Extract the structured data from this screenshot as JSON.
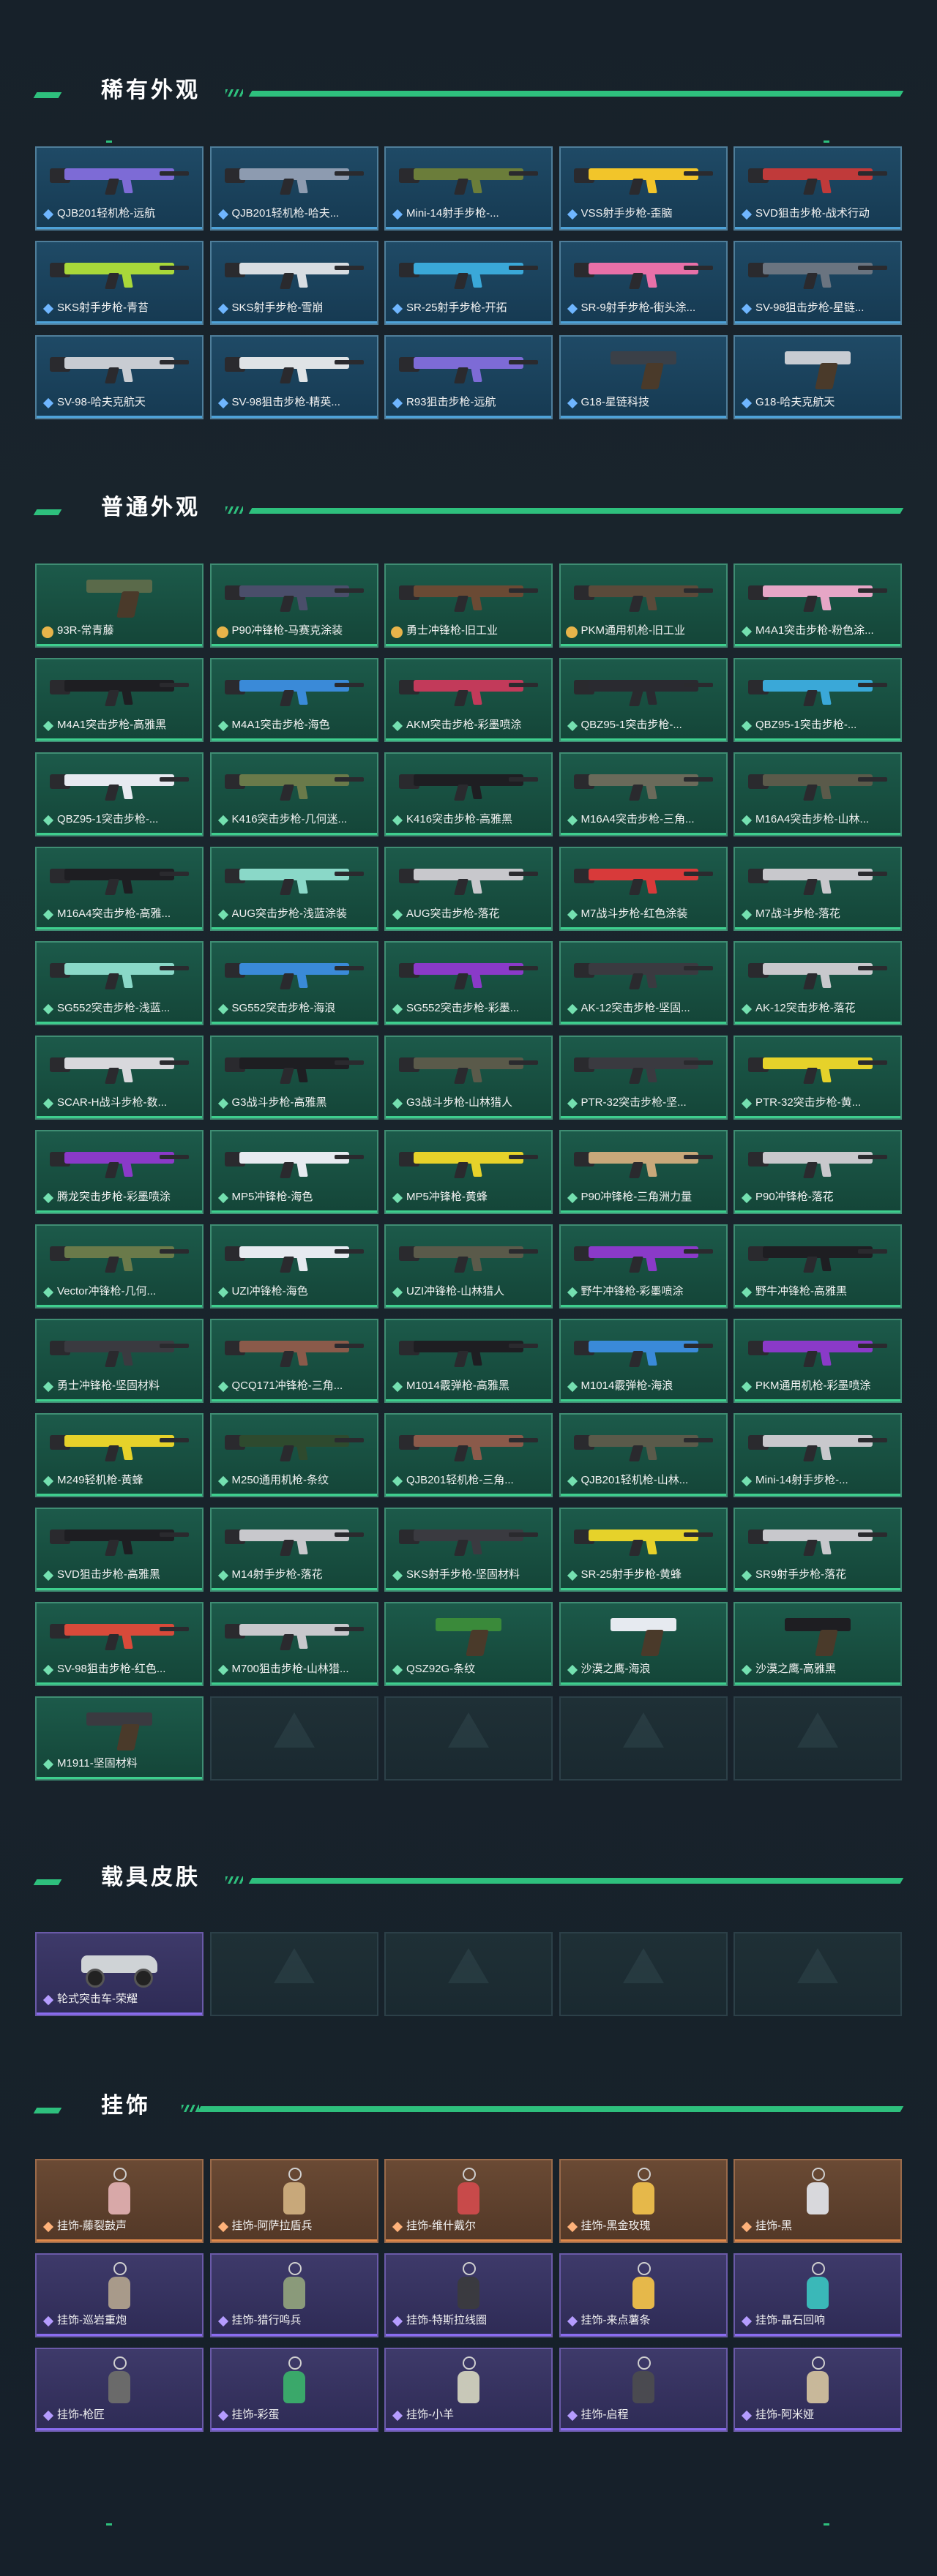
{
  "sections": {
    "rare": "稀有外观",
    "normal": "普通外观",
    "vehicle": "载具皮肤",
    "charm": "挂饰"
  },
  "rare_items": [
    {
      "label": "QJB201轻机枪-远航",
      "color": "#7d6bd6"
    },
    {
      "label": "QJB201轻机枪-哈夫...",
      "color": "#8d9bb0"
    },
    {
      "label": "Mini-14射手步枪-...",
      "color": "#6b7d3a"
    },
    {
      "label": "VSS射手步枪-歪脑",
      "color": "#f2c52a"
    },
    {
      "label": "SVD狙击步枪-战术行动",
      "color": "#c03a3a"
    },
    {
      "label": "SKS射手步枪-青苔",
      "color": "#a8d83a"
    },
    {
      "label": "SKS射手步枪-雪崩",
      "color": "#d8dde2"
    },
    {
      "label": "SR-25射手步枪-开拓",
      "color": "#3aa8d8"
    },
    {
      "label": "SR-9射手步枪-街头涂...",
      "color": "#e870a8"
    },
    {
      "label": "SV-98狙击步枪-星链...",
      "color": "#6a7480"
    },
    {
      "label": "SV-98-哈夫克航天",
      "color": "#c8ccd2"
    },
    {
      "label": "SV-98狙击步枪-精英...",
      "color": "#dfe3e6"
    },
    {
      "label": "R93狙击步枪-远航",
      "color": "#7d6bd6"
    },
    {
      "label": "G18-星链科技",
      "color": "#3a4048"
    },
    {
      "label": "G18-哈夫克航天",
      "color": "#c8ccd2"
    }
  ],
  "normal_items": [
    {
      "label": "93R-常青藤",
      "color": "#5a6a4a",
      "type": "pistol",
      "rank": "medal"
    },
    {
      "label": "P90冲锋枪-马赛克涂装",
      "color": "#4a4e6a",
      "type": "gun",
      "rank": "medal"
    },
    {
      "label": "勇士冲锋枪-旧工业",
      "color": "#6a4a34",
      "type": "gun",
      "rank": "medal"
    },
    {
      "label": "PKM通用机枪-旧工业",
      "color": "#5a4a3a",
      "type": "gun",
      "rank": "medal"
    },
    {
      "label": "M4A1突击步枪-粉色涂...",
      "color": "#e6a6c6",
      "type": "gun",
      "rank": "diamond"
    },
    {
      "label": "M4A1突击步枪-高雅黑",
      "color": "#1e1e22",
      "type": "gun",
      "rank": "diamond"
    },
    {
      "label": "M4A1突击步枪-海色",
      "color": "#3a8ad8",
      "type": "gun",
      "rank": "diamond"
    },
    {
      "label": "AKM突击步枪-彩墨喷涂",
      "color": "#c23a5a",
      "type": "gun",
      "rank": "diamond"
    },
    {
      "label": "QBZ95-1突击步枪-...",
      "color": "#2a2a30",
      "type": "gun",
      "rank": "diamond"
    },
    {
      "label": "QBZ95-1突击步枪-...",
      "color": "#3aa8d8",
      "type": "gun",
      "rank": "diamond"
    },
    {
      "label": "QBZ95-1突击步枪-...",
      "color": "#e6eaf0",
      "type": "gun",
      "rank": "diamond"
    },
    {
      "label": "K416突击步枪-几何迷...",
      "color": "#6a7a4a",
      "type": "gun",
      "rank": "diamond"
    },
    {
      "label": "K416突击步枪-高雅黑",
      "color": "#1e1e22",
      "type": "gun",
      "rank": "diamond"
    },
    {
      "label": "M16A4突击步枪-三角...",
      "color": "#6a6a5a",
      "type": "gun",
      "rank": "diamond"
    },
    {
      "label": "M16A4突击步枪-山林...",
      "color": "#5a5a4a",
      "type": "gun",
      "rank": "diamond"
    },
    {
      "label": "M16A4突击步枪-高雅...",
      "color": "#1e1e22",
      "type": "gun",
      "rank": "diamond"
    },
    {
      "label": "AUG突击步枪-浅蓝涂装",
      "color": "#8ad8c8",
      "type": "gun",
      "rank": "diamond"
    },
    {
      "label": "AUG突击步枪-落花",
      "color": "#c8c8cc",
      "type": "gun",
      "rank": "diamond"
    },
    {
      "label": "M7战斗步枪-红色涂装",
      "color": "#d83a3a",
      "type": "gun",
      "rank": "diamond"
    },
    {
      "label": "M7战斗步枪-落花",
      "color": "#c8c8cc",
      "type": "gun",
      "rank": "diamond"
    },
    {
      "label": "SG552突击步枪-浅蓝...",
      "color": "#8ad8c8",
      "type": "gun",
      "rank": "diamond"
    },
    {
      "label": "SG552突击步枪-海浪",
      "color": "#3a8ad8",
      "type": "gun",
      "rank": "diamond"
    },
    {
      "label": "SG552突击步枪-彩墨...",
      "color": "#8a3ac8",
      "type": "gun",
      "rank": "diamond"
    },
    {
      "label": "AK-12突击步枪-坚固...",
      "color": "#3a3a40",
      "type": "gun",
      "rank": "diamond"
    },
    {
      "label": "AK-12突击步枪-落花",
      "color": "#c8c8cc",
      "type": "gun",
      "rank": "diamond"
    },
    {
      "label": "SCAR-H战斗步枪-数...",
      "color": "#d8d8dc",
      "type": "gun",
      "rank": "diamond"
    },
    {
      "label": "G3战斗步枪-高雅黑",
      "color": "#1e1e22",
      "type": "gun",
      "rank": "diamond"
    },
    {
      "label": "G3战斗步枪-山林猎人",
      "color": "#5a5a4a",
      "type": "gun",
      "rank": "diamond"
    },
    {
      "label": "PTR-32突击步枪-坚...",
      "color": "#3a3a40",
      "type": "gun",
      "rank": "diamond"
    },
    {
      "label": "PTR-32突击步枪-黄...",
      "color": "#e6d22a",
      "type": "gun",
      "rank": "diamond"
    },
    {
      "label": "腾龙突击步枪-彩墨喷涂",
      "color": "#8a3ac8",
      "type": "gun",
      "rank": "diamond"
    },
    {
      "label": "MP5冲锋枪-海色",
      "color": "#e6eaf0",
      "type": "gun",
      "rank": "diamond"
    },
    {
      "label": "MP5冲锋枪-黄蜂",
      "color": "#e6d22a",
      "type": "gun",
      "rank": "diamond"
    },
    {
      "label": "P90冲锋枪-三角洲力量",
      "color": "#c8a87a",
      "type": "gun",
      "rank": "diamond"
    },
    {
      "label": "P90冲锋枪-落花",
      "color": "#c8c8cc",
      "type": "gun",
      "rank": "diamond"
    },
    {
      "label": "Vector冲锋枪-几何...",
      "color": "#6a7a4a",
      "type": "gun",
      "rank": "diamond"
    },
    {
      "label": "UZI冲锋枪-海色",
      "color": "#e6eaf0",
      "type": "gun",
      "rank": "diamond"
    },
    {
      "label": "UZI冲锋枪-山林猎人",
      "color": "#5a5a4a",
      "type": "gun",
      "rank": "diamond"
    },
    {
      "label": "野牛冲锋枪-彩墨喷涂",
      "color": "#8a3ac8",
      "type": "gun",
      "rank": "diamond"
    },
    {
      "label": "野牛冲锋枪-高雅黑",
      "color": "#1e1e22",
      "type": "gun",
      "rank": "diamond"
    },
    {
      "label": "勇士冲锋枪-坚固材料",
      "color": "#3a3a40",
      "type": "gun",
      "rank": "diamond"
    },
    {
      "label": "QCQ171冲锋枪-三角...",
      "color": "#8a5a4a",
      "type": "gun",
      "rank": "diamond"
    },
    {
      "label": "M1014霰弹枪-高雅黑",
      "color": "#1e1e22",
      "type": "gun",
      "rank": "diamond"
    },
    {
      "label": "M1014霰弹枪-海浪",
      "color": "#3a8ad8",
      "type": "gun",
      "rank": "diamond"
    },
    {
      "label": "PKM通用机枪-彩墨喷涂",
      "color": "#8a3ac8",
      "type": "gun",
      "rank": "diamond"
    },
    {
      "label": "M249轻机枪-黄蜂",
      "color": "#e6d22a",
      "type": "gun",
      "rank": "diamond"
    },
    {
      "label": "M250通用机枪-条纹",
      "color": "#2e4a2e",
      "type": "gun",
      "rank": "diamond"
    },
    {
      "label": "QJB201轻机枪-三角...",
      "color": "#8a5a4a",
      "type": "gun",
      "rank": "diamond"
    },
    {
      "label": "QJB201轻机枪-山林...",
      "color": "#5a5a4a",
      "type": "gun",
      "rank": "diamond"
    },
    {
      "label": "Mini-14射手步枪-...",
      "color": "#c8c8cc",
      "type": "gun",
      "rank": "diamond"
    },
    {
      "label": "SVD狙击步枪-高雅黑",
      "color": "#1e1e22",
      "type": "gun",
      "rank": "diamond"
    },
    {
      "label": "M14射手步枪-落花",
      "color": "#c8c8cc",
      "type": "gun",
      "rank": "diamond"
    },
    {
      "label": "SKS射手步枪-坚固材料",
      "color": "#3a3a40",
      "type": "gun",
      "rank": "diamond"
    },
    {
      "label": "SR-25射手步枪-黄蜂",
      "color": "#e6d22a",
      "type": "gun",
      "rank": "diamond"
    },
    {
      "label": "SR9射手步枪-落花",
      "color": "#c8c8cc",
      "type": "gun",
      "rank": "diamond"
    },
    {
      "label": "SV-98狙击步枪-红色...",
      "color": "#d84a3a",
      "type": "gun",
      "rank": "diamond"
    },
    {
      "label": "M700狙击步枪-山林猎...",
      "color": "#c8c8cc",
      "type": "gun",
      "rank": "diamond"
    },
    {
      "label": "QSZ92G-条纹",
      "color": "#3a8a3a",
      "type": "pistol",
      "rank": "diamond"
    },
    {
      "label": "沙漠之鹰-海浪",
      "color": "#e6eaf0",
      "type": "pistol",
      "rank": "diamond"
    },
    {
      "label": "沙漠之鹰-高雅黑",
      "color": "#1e1e22",
      "type": "pistol",
      "rank": "diamond"
    },
    {
      "label": "M1911-坚固材料",
      "color": "#3a3a40",
      "type": "pistol",
      "rank": "diamond"
    }
  ],
  "vehicle_items": [
    {
      "label": "轮式突击车-荣耀",
      "color": "#cfd3d6"
    }
  ],
  "charm_items": [
    {
      "label": "挂饰-藤裂鼓声",
      "color": "#d8a8a8",
      "rank": "orange"
    },
    {
      "label": "挂饰-阿萨拉盾兵",
      "color": "#c8a87a",
      "rank": "orange"
    },
    {
      "label": "挂饰-维什戴尔",
      "color": "#c84a4a",
      "rank": "orange"
    },
    {
      "label": "挂饰-黑金玫瑰",
      "color": "#e6b84a",
      "rank": "orange"
    },
    {
      "label": "挂饰-黑",
      "color": "#d8d8dc",
      "rank": "orange"
    },
    {
      "label": "挂饰-巡岩重炮",
      "color": "#a89a8a",
      "rank": "purple"
    },
    {
      "label": "挂饰-猎行鸣兵",
      "color": "#8a9a7a",
      "rank": "purple"
    },
    {
      "label": "挂饰-特斯拉线圈",
      "color": "#3a3a40",
      "rank": "purple"
    },
    {
      "label": "挂饰-来点薯条",
      "color": "#e6b84a",
      "rank": "purple"
    },
    {
      "label": "挂饰-晶石回响",
      "color": "#3ab8b8",
      "rank": "purple"
    },
    {
      "label": "挂饰-枪匠",
      "color": "#6a6a6a",
      "rank": "purple"
    },
    {
      "label": "挂饰-彩蛋",
      "color": "#3aa86a",
      "rank": "purple"
    },
    {
      "label": "挂饰-小羊",
      "color": "#c8c8b8",
      "rank": "purple"
    },
    {
      "label": "挂饰-启程",
      "color": "#4a4a50",
      "rank": "purple"
    },
    {
      "label": "挂饰-阿米娅",
      "color": "#c8b89a",
      "rank": "purple"
    }
  ]
}
